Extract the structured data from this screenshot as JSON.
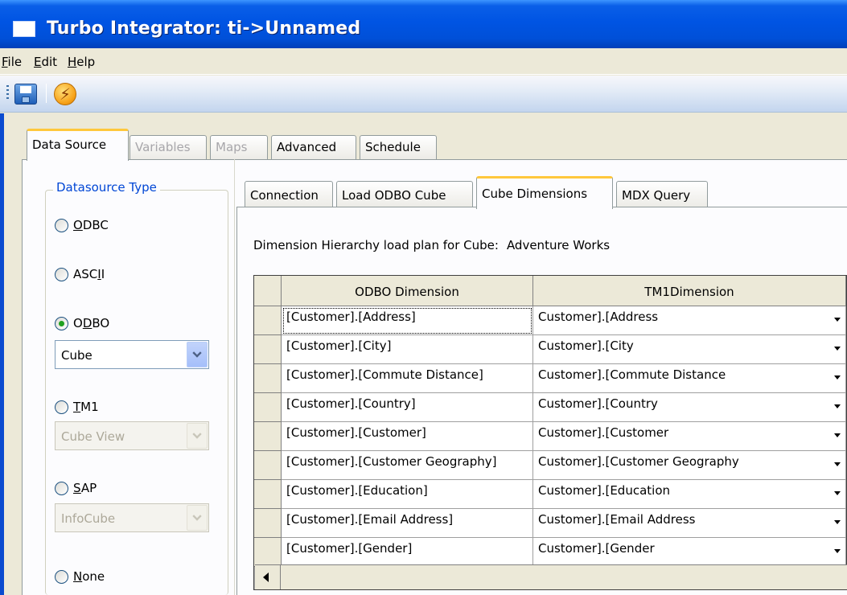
{
  "window": {
    "title": "Turbo Integrator:  ti->Unnamed"
  },
  "menu": [
    {
      "label": "File",
      "key": "F",
      "rest": "ile"
    },
    {
      "label": "Edit",
      "key": "E",
      "rest": "dit"
    },
    {
      "label": "Help",
      "key": "H",
      "rest": "elp"
    }
  ],
  "toolbar": {
    "save_icon": "save-icon",
    "run_icon": "lightning-icon"
  },
  "outer_tabs": [
    {
      "label": "Data Source",
      "state": "active"
    },
    {
      "label": "Variables",
      "state": "disabled"
    },
    {
      "label": "Maps",
      "state": "disabled"
    },
    {
      "label": "Advanced",
      "state": "normal"
    },
    {
      "label": "Schedule",
      "state": "normal"
    }
  ],
  "datasource": {
    "group_title": "Datasource Type",
    "options": [
      {
        "label": "ODBC",
        "key": "O",
        "rest": "DBC",
        "checked": false
      },
      {
        "label": "ASCII",
        "pre": "ASC",
        "key": "I",
        "rest": "I",
        "checked": false
      },
      {
        "label": "ODBO",
        "pre": "O",
        "key": "D",
        "rest": "BO",
        "checked": true
      },
      {
        "label": "TM1",
        "key": "T",
        "rest": "M1",
        "checked": false
      },
      {
        "label": "SAP",
        "key": "S",
        "rest": "AP",
        "checked": false
      },
      {
        "label": "None",
        "key": "N",
        "rest": "one",
        "checked": false
      }
    ],
    "odbo_select": "Cube",
    "tm1_select": "Cube View",
    "sap_select": "InfoCube"
  },
  "inner_tabs": [
    {
      "label": "Connection",
      "state": "normal"
    },
    {
      "label": "Load ODBO Cube",
      "state": "normal"
    },
    {
      "label": "Cube Dimensions",
      "state": "active"
    },
    {
      "label": "MDX Query",
      "state": "normal"
    }
  ],
  "plan": {
    "label": "Dimension Hierarchy load plan for Cube:",
    "cube": "Adventure Works"
  },
  "grid": {
    "columns": [
      "ODBO Dimension",
      "TM1Dimension"
    ],
    "rows": [
      [
        "[Customer].[Address]",
        "Customer].[Address"
      ],
      [
        "[Customer].[City]",
        "Customer].[City"
      ],
      [
        "[Customer].[Commute Distance]",
        "Customer].[Commute Distance"
      ],
      [
        "[Customer].[Country]",
        "Customer].[Country"
      ],
      [
        "[Customer].[Customer]",
        "Customer].[Customer"
      ],
      [
        "[Customer].[Customer Geography]",
        "Customer].[Customer Geography"
      ],
      [
        "[Customer].[Education]",
        "Customer].[Education"
      ],
      [
        "[Customer].[Email Address]",
        "Customer].[Email Address"
      ],
      [
        "[Customer].[Gender]",
        "Customer].[Gender"
      ]
    ]
  }
}
